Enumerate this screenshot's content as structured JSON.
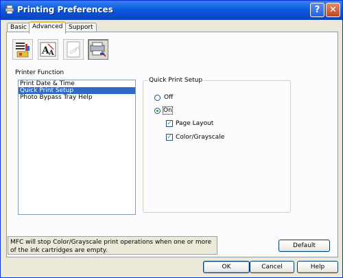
{
  "window": {
    "title": "Printing Preferences",
    "help_label": "?",
    "close_label": "✕"
  },
  "tabs": [
    {
      "label": "Basic",
      "active": false
    },
    {
      "label": "Advanced",
      "active": true
    },
    {
      "label": "Support",
      "active": false
    }
  ],
  "toolbar": {
    "icons": [
      "color-quality-icon",
      "text-scaling-icon",
      "copy-watermark-icon",
      "device-options-icon"
    ],
    "selected_index": 3
  },
  "printer_function": {
    "label": "Printer Function",
    "items": [
      {
        "label": "Print Date & Time",
        "selected": false
      },
      {
        "label": "Quick Print Setup",
        "selected": true
      },
      {
        "label": "Photo Bypass Tray Help",
        "selected": false
      }
    ]
  },
  "quick_print": {
    "title": "Quick Print Setup",
    "off_label": "Off",
    "on_label": "On",
    "selected": "On",
    "page_layout_label": "Page Layout",
    "page_layout_checked": true,
    "color_grayscale_label": "Color/Grayscale",
    "color_grayscale_checked": true
  },
  "status_text": "MFC will stop Color/Grayscale print operations when one or more of the ink cartridges are empty.",
  "buttons": {
    "default": "Default",
    "ok": "OK",
    "cancel": "Cancel",
    "help": "Help"
  },
  "colors": {
    "titlebar": "#0a4fd0",
    "selection": "#316ac5",
    "dialog_bg": "#ece9d8"
  }
}
